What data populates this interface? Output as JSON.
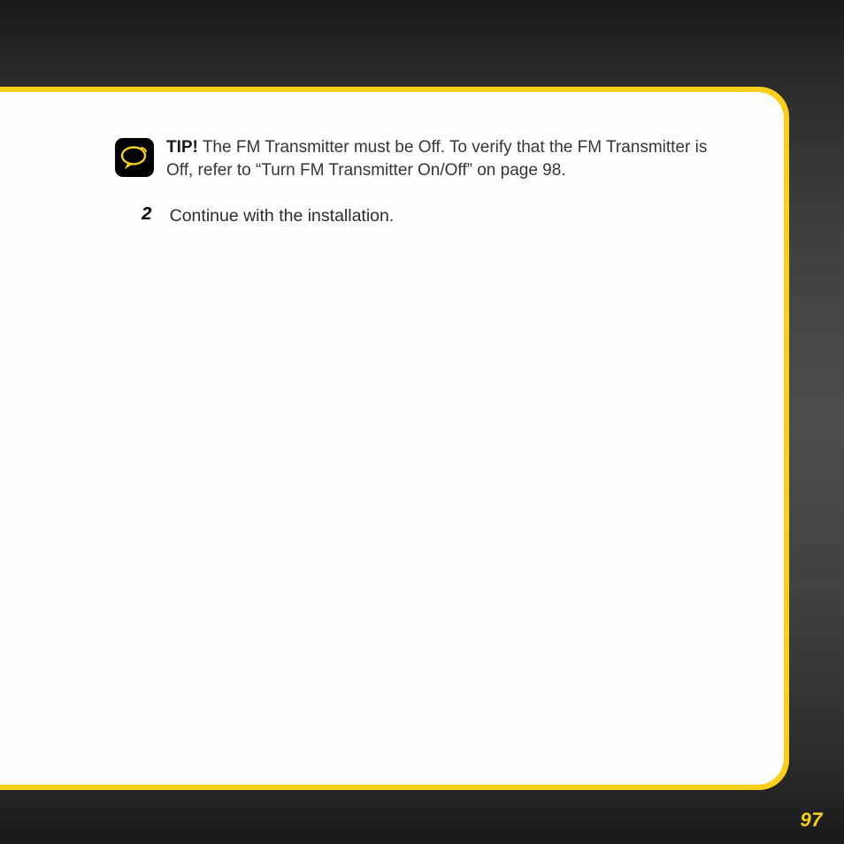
{
  "tip": {
    "label": "TIP!",
    "text": "The FM Transmitter must be Off. To verify that the FM Transmitter is Off, refer to “Turn FM Transmitter On/Off” on page 98."
  },
  "step": {
    "number": "2",
    "text": "Continue with the installation."
  },
  "page_number": "97"
}
